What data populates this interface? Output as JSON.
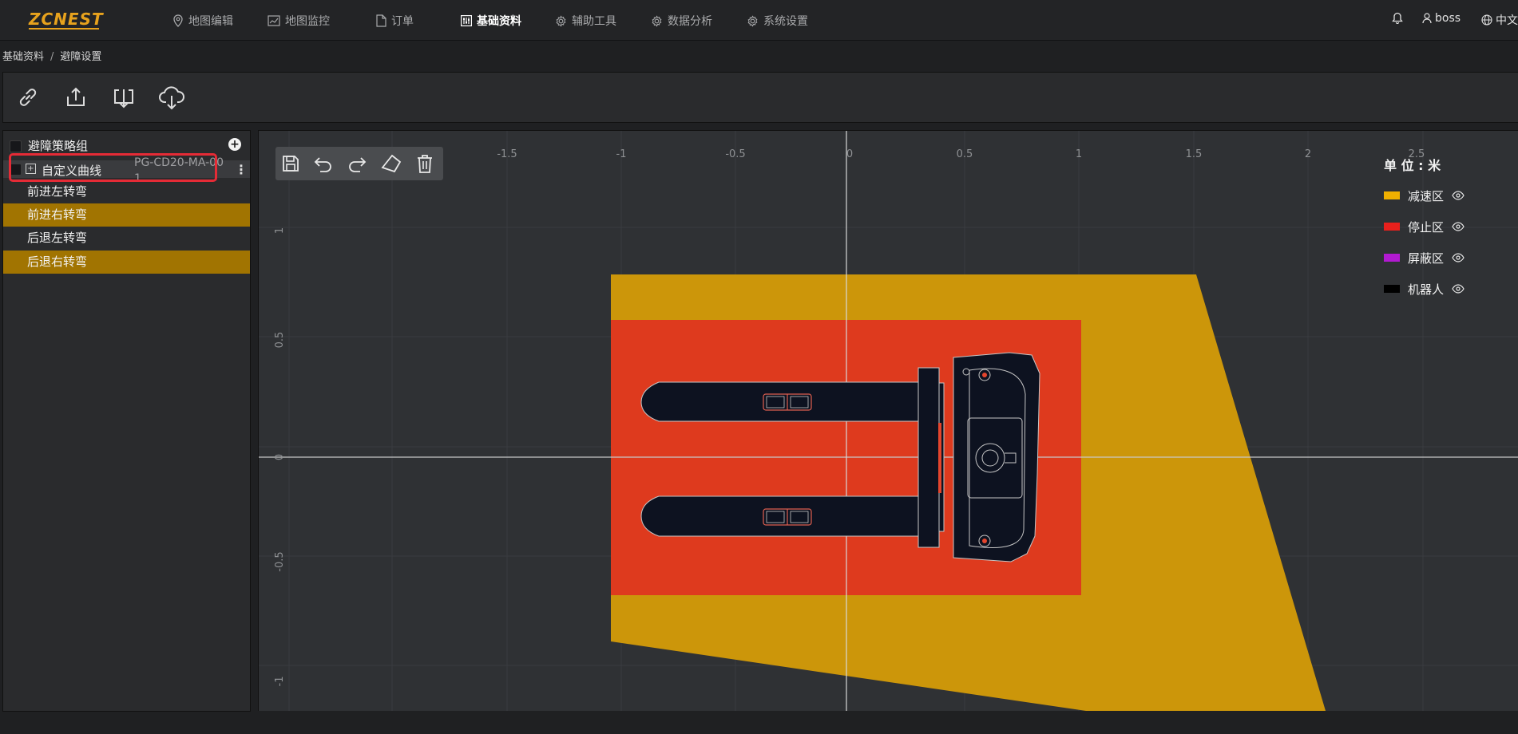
{
  "nav": {
    "logo": "ZCNEST",
    "items": [
      {
        "label": "地图编辑",
        "icon": "map-pin-icon"
      },
      {
        "label": "地图监控",
        "icon": "chart-icon"
      },
      {
        "label": "订单",
        "icon": "document-icon"
      },
      {
        "label": "基础资料",
        "icon": "sliders-icon",
        "active": true
      },
      {
        "label": "辅助工具",
        "icon": "gear-icon"
      },
      {
        "label": "数据分析",
        "icon": "gear-icon"
      },
      {
        "label": "系统设置",
        "icon": "gear-icon"
      }
    ],
    "user": "boss",
    "language": "中文"
  },
  "breadcrumb": {
    "items": [
      "基础资料",
      "避障设置"
    ]
  },
  "toolbar": {
    "buttons": [
      "link-icon",
      "upload-icon",
      "download-icon",
      "cloud-download-icon"
    ]
  },
  "left_panel": {
    "group_label": "避障策略组",
    "add_label": "+",
    "curve": {
      "expand_label": "+",
      "label": "自定义曲线",
      "device": "PG-CD20-MA-001",
      "more_label": "⋮"
    },
    "strategies": [
      {
        "label": "前进左转弯",
        "selected": false
      },
      {
        "label": "前进右转弯",
        "selected": true
      },
      {
        "label": "后退左转弯",
        "selected": false
      },
      {
        "label": "后退右转弯",
        "selected": true
      }
    ]
  },
  "canvas": {
    "edit_tools": [
      "save-icon",
      "undo-icon",
      "redo-icon",
      "polygon-icon",
      "delete-icon"
    ],
    "x_ticks": [
      "-1.5",
      "-1",
      "-0.5",
      "0",
      "0.5",
      "1",
      "1.5",
      "2",
      "2.5"
    ],
    "y_ticks": [
      "1",
      "0.5",
      "0",
      "-0.5",
      "-1"
    ],
    "unit_label": "单 位 : 米",
    "legend": [
      {
        "label": "减速区",
        "color": "#f0b000"
      },
      {
        "label": "停止区",
        "color": "#e8201c"
      },
      {
        "label": "屏蔽区",
        "color": "#b21ad1"
      },
      {
        "label": "机器人",
        "color": "#000000"
      }
    ],
    "zones": {
      "slowdown_color": "#cc960a",
      "stop_color": "#de3a1e",
      "robot_color": "#0d1220"
    }
  }
}
